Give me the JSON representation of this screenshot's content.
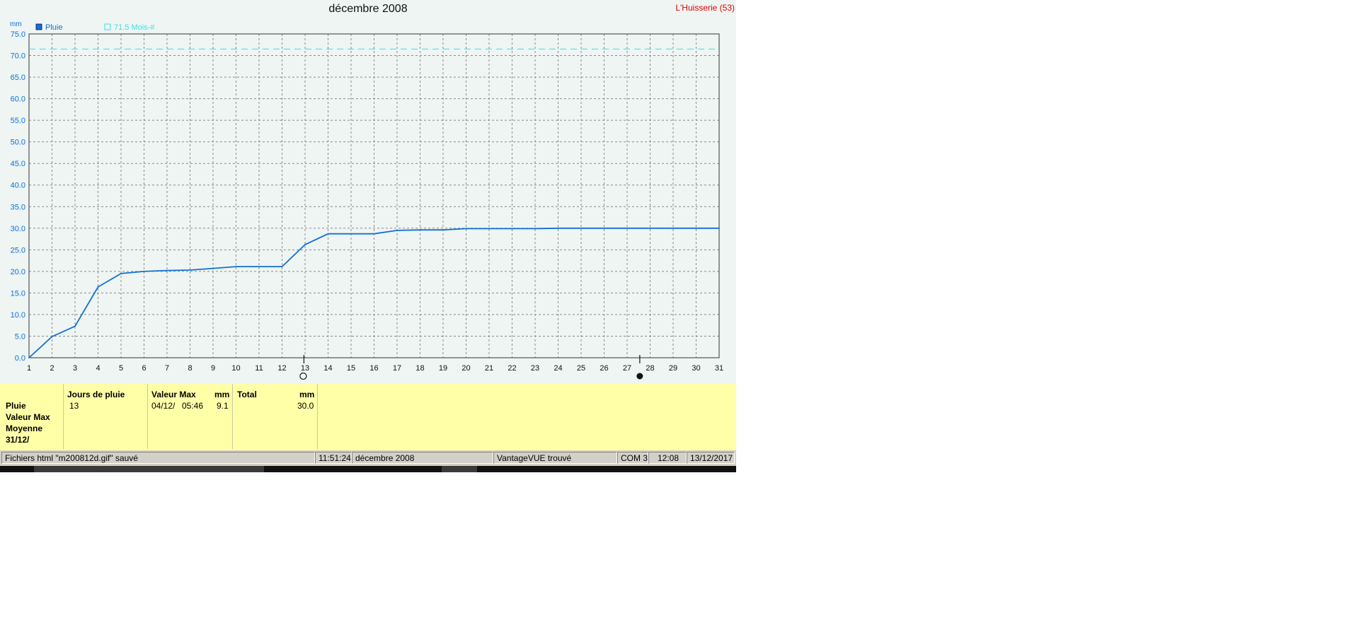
{
  "chart_data": {
    "type": "line",
    "title": "décembre 2008",
    "ylabel": "mm",
    "ylim": [
      0,
      75
    ],
    "xlim": [
      1,
      31
    ],
    "grid": true,
    "y_ticks": [
      "0.0",
      "5.0",
      "10.0",
      "15.0",
      "20.0",
      "25.0",
      "30.0",
      "35.0",
      "40.0",
      "45.0",
      "50.0",
      "55.0",
      "60.0",
      "65.0",
      "70.0",
      "75.0"
    ],
    "x_ticks": [
      "1",
      "2",
      "3",
      "4",
      "5",
      "6",
      "7",
      "8",
      "9",
      "10",
      "11",
      "12",
      "13",
      "14",
      "15",
      "16",
      "17",
      "18",
      "19",
      "20",
      "21",
      "22",
      "23",
      "24",
      "25",
      "26",
      "27",
      "28",
      "29",
      "30",
      "31"
    ],
    "legend_position": "top-left",
    "series": [
      {
        "name": "Pluie",
        "color": "#1070d8",
        "x": [
          1,
          2,
          3,
          4,
          5,
          6,
          7,
          8,
          9,
          10,
          11,
          12,
          13,
          14,
          15,
          16,
          17,
          18,
          19,
          20,
          21,
          22,
          23,
          24,
          25,
          26,
          27,
          28,
          29,
          30,
          31
        ],
        "values": [
          0.0,
          4.9,
          7.3,
          16.4,
          19.5,
          20.0,
          20.2,
          20.3,
          20.7,
          21.1,
          21.1,
          21.1,
          26.2,
          28.7,
          28.7,
          28.7,
          29.5,
          29.6,
          29.6,
          29.9,
          29.9,
          29.9,
          29.9,
          30.0,
          30.0,
          30.0,
          30.0,
          30.0,
          30.0,
          30.0,
          30.0
        ]
      }
    ],
    "reference_line": {
      "name": "71.5 Mois-#",
      "value": 71.5,
      "color": "#40e0e0"
    },
    "moon_phases": [
      {
        "day": 12.95,
        "phase": "full-moon"
      },
      {
        "day": 27.55,
        "phase": "new-moon"
      }
    ]
  },
  "station": "L'Huisserie (53)",
  "summary": {
    "labels": [
      "Pluie",
      "Valeur Max",
      "Moyenne",
      "31/12/"
    ],
    "jours": {
      "header": "Jours de pluie",
      "value": "13"
    },
    "valeur_max": {
      "header": "Valeur Max",
      "unit": "mm",
      "date": "04/12/",
      "time": "05:46",
      "value": "9.1"
    },
    "total": {
      "header": "Total",
      "unit": "mm",
      "value": "30.0"
    }
  },
  "statusbar": {
    "message": "Fichiers html  \"m200812d.gif\"  sauvé",
    "time": "11:51:24",
    "period": "décembre 2008",
    "station_status": "VantageVUE trouvé",
    "port": "COM 3",
    "clock": "12:08",
    "date": "13/12/2017"
  },
  "colors": {
    "plot_bg": "#eef5f3",
    "axis_text": "#1070d8",
    "summary_bg": "#ffffa8",
    "station_text": "#e00000"
  }
}
